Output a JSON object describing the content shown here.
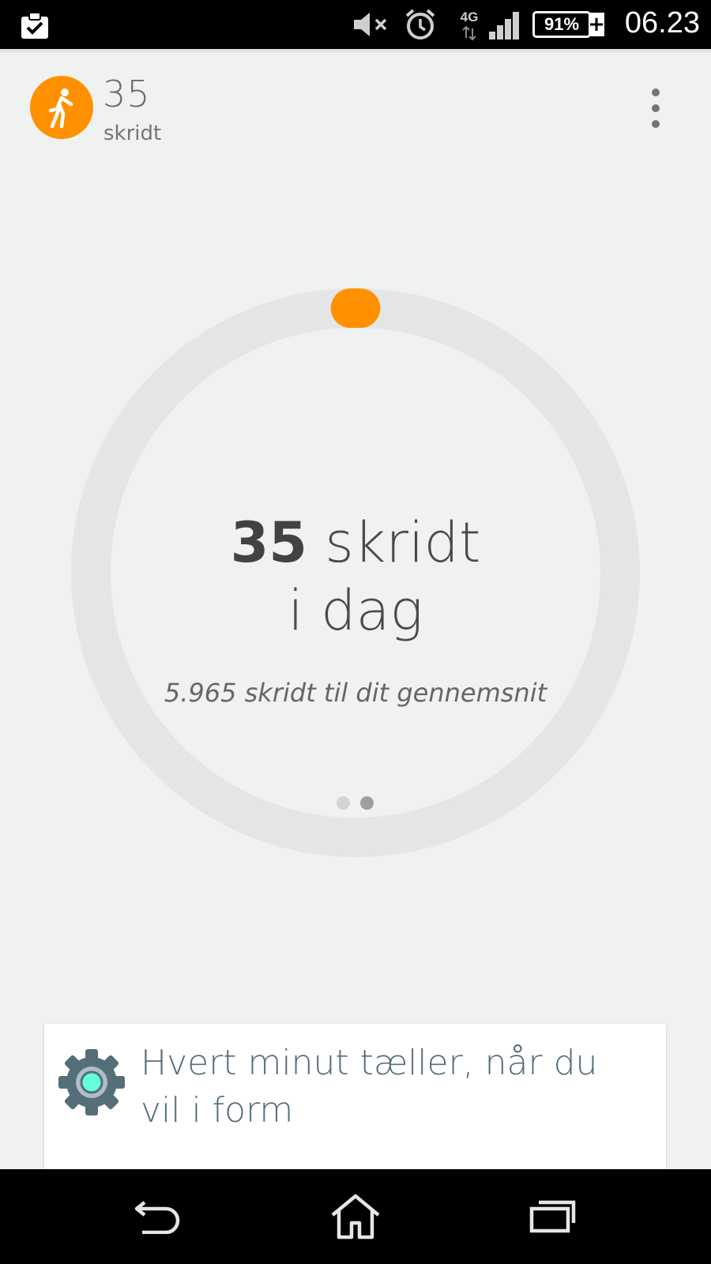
{
  "status_bar": {
    "network_type": "4G",
    "battery_percent": "91%",
    "time": "06.23"
  },
  "header": {
    "count": "35",
    "unit": "skridt"
  },
  "ring": {
    "progress_fraction": 0.006,
    "track_color": "#e4e5e5",
    "progress_color": "#ff9100"
  },
  "center": {
    "count": "35",
    "unit": "skridt",
    "period": "i dag",
    "subtitle": "5.965 skridt til dit gennemsnit"
  },
  "pager": {
    "total": 2,
    "active_index": 1
  },
  "card": {
    "icon": "gear-icon",
    "text": "Hvert minut tæller, når du vil i form"
  },
  "colors": {
    "accent": "#ff9100",
    "background": "#f0f1f1",
    "card_text": "#546e7a"
  }
}
